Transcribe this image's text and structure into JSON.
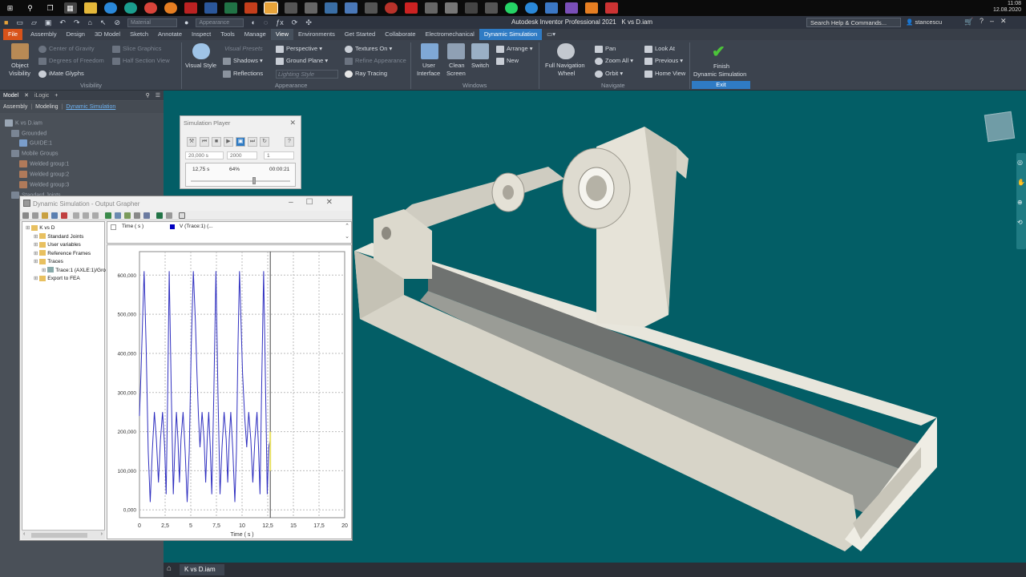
{
  "taskbar": {
    "clock_time": "11:08",
    "clock_date": "12.08.2020"
  },
  "titlebar": {
    "app_title": "Autodesk Inventor Professional 2021",
    "doc_title": "K vs D.iam",
    "material_combo": "Material",
    "appearance_combo": "Appearance",
    "search_placeholder": "Search Help & Commands...",
    "user": "stancescu"
  },
  "tabs": [
    "File",
    "Assembly",
    "Design",
    "3D Model",
    "Sketch",
    "Annotate",
    "Inspect",
    "Tools",
    "Manage",
    "View",
    "Environments",
    "Get Started",
    "Collaborate",
    "Electromechanical",
    "Dynamic Simulation"
  ],
  "ribbon": {
    "visibility": {
      "object_visibility": "Object",
      "object_visibility2": "Visibility",
      "center_of_gravity": "Center of Gravity",
      "degrees_of_freedom": "Degrees of Freedom",
      "imate_glyphs": "iMate Glyphs",
      "slice_graphics": "Slice Graphics",
      "half_section": "Half Section View",
      "label": "Visibility"
    },
    "appearance": {
      "visual_style": "Visual Style",
      "visual_presets": "Visual Presets",
      "shadows": "Shadows",
      "reflections": "Reflections",
      "perspective": "Perspective",
      "ground_plane": "Ground Plane",
      "lighting_style": "Lighting Style",
      "textures_on": "Textures On",
      "refine_appearance": "Refine Appearance",
      "ray_tracing": "Ray Tracing",
      "label": "Appearance"
    },
    "windows": {
      "user_interface": "User",
      "user_interface2": "Interface",
      "clean_screen": "Clean",
      "clean_screen2": "Screen",
      "switch": "Switch",
      "arrange": "Arrange",
      "new": "New",
      "label": "Windows"
    },
    "navigate": {
      "full_nav_wheel": "Full Navigation",
      "full_nav_wheel2": "Wheel",
      "pan": "Pan",
      "zoom_all": "Zoom All",
      "orbit": "Orbit",
      "look_at": "Look At",
      "previous": "Previous",
      "home_view": "Home View",
      "label": "Navigate"
    },
    "exit": {
      "finish": "Finish",
      "finish2": "Dynamic Simulation",
      "label": "Exit"
    }
  },
  "browser": {
    "tabs": [
      "Model",
      "iLogic"
    ],
    "subtabs": [
      "Assembly",
      "Modeling",
      "Dynamic Simulation"
    ],
    "tree": [
      "K vs D.iam",
      "Grounded",
      "GUIDE:1",
      "Mobile Groups",
      "Welded group:1",
      "Welded group:2",
      "Welded group:3",
      "Standard Joints"
    ]
  },
  "sim_player": {
    "title": "Simulation Player",
    "end_time": "20,000 s",
    "images": "2000",
    "filter": "1",
    "current_time": "12,75 s",
    "percent": "64%",
    "elapsed": "00:00:21",
    "progress": 0.64
  },
  "grapher": {
    "title": "Dynamic Simulation - Output Grapher",
    "tree": [
      {
        "label": "K vs D",
        "level": 0
      },
      {
        "label": "Standard Joints",
        "level": 1
      },
      {
        "label": "User variables",
        "level": 1
      },
      {
        "label": "Reference Frames",
        "level": 1
      },
      {
        "label": "Traces",
        "level": 1
      },
      {
        "label": "Trace:1 (AXLE:1)/Gro",
        "level": 2
      },
      {
        "label": "Export to FEA",
        "level": 1
      }
    ],
    "list_header_time": "Time ( s )",
    "list_header_series": "V (Trace:1) (..."
  },
  "colors": {
    "viewport": "#035e66",
    "accent": "#2f7bc4",
    "file_tab": "#d8531a",
    "series": "#3030c0"
  },
  "chart_data": {
    "type": "line",
    "xlabel": "Time ( s )",
    "ylabel": "",
    "xlim": [
      0,
      20
    ],
    "ylim": [
      -20000,
      660000
    ],
    "x_ticks": [
      "0",
      "2,5",
      "5",
      "7,5",
      "10",
      "12,5",
      "15",
      "17,5",
      "20"
    ],
    "y_ticks": [
      "0,000",
      "100,000",
      "200,000",
      "300,000",
      "400,000",
      "500,000",
      "600,000"
    ],
    "grid": true,
    "cursor_x": 12.75,
    "series": [
      {
        "name": "V (Trace:1) (...",
        "x": [
          0,
          0.15,
          0.3,
          0.45,
          0.65,
          0.85,
          1.05,
          1.25,
          1.45,
          1.65,
          1.85,
          2.05,
          2.25,
          2.45,
          2.6,
          2.75,
          2.9,
          3.1,
          3.3,
          3.45,
          3.6,
          3.75,
          3.9,
          4.05,
          4.25,
          4.45,
          4.65,
          4.85,
          5.05,
          5.25,
          5.45,
          5.6,
          5.75,
          5.9,
          6.1,
          6.3,
          6.45,
          6.6,
          6.75,
          6.9,
          7.05,
          7.25,
          7.45,
          7.65,
          7.85,
          8.05,
          8.25,
          8.45,
          8.6,
          8.75,
          8.9,
          9.1,
          9.3,
          9.45,
          9.6,
          9.75,
          9.9,
          10.05,
          10.25,
          10.45,
          10.65,
          10.85,
          11.05,
          11.25,
          11.45,
          11.6,
          11.75,
          11.9,
          12.1,
          12.3,
          12.45,
          12.6,
          12.75
        ],
        "values": [
          240000,
          350000,
          480000,
          610000,
          420000,
          150000,
          20000,
          150000,
          250000,
          180000,
          70000,
          180000,
          250000,
          160000,
          40000,
          300000,
          610000,
          300000,
          40000,
          160000,
          250000,
          180000,
          70000,
          180000,
          250000,
          150000,
          20000,
          150000,
          420000,
          610000,
          480000,
          350000,
          240000,
          160000,
          250000,
          180000,
          70000,
          180000,
          250000,
          160000,
          40000,
          300000,
          610000,
          300000,
          40000,
          160000,
          250000,
          180000,
          70000,
          180000,
          250000,
          150000,
          20000,
          150000,
          420000,
          610000,
          480000,
          350000,
          240000,
          160000,
          250000,
          180000,
          70000,
          180000,
          250000,
          160000,
          40000,
          300000,
          610000,
          300000,
          40000,
          160000,
          180000
        ]
      }
    ]
  }
}
